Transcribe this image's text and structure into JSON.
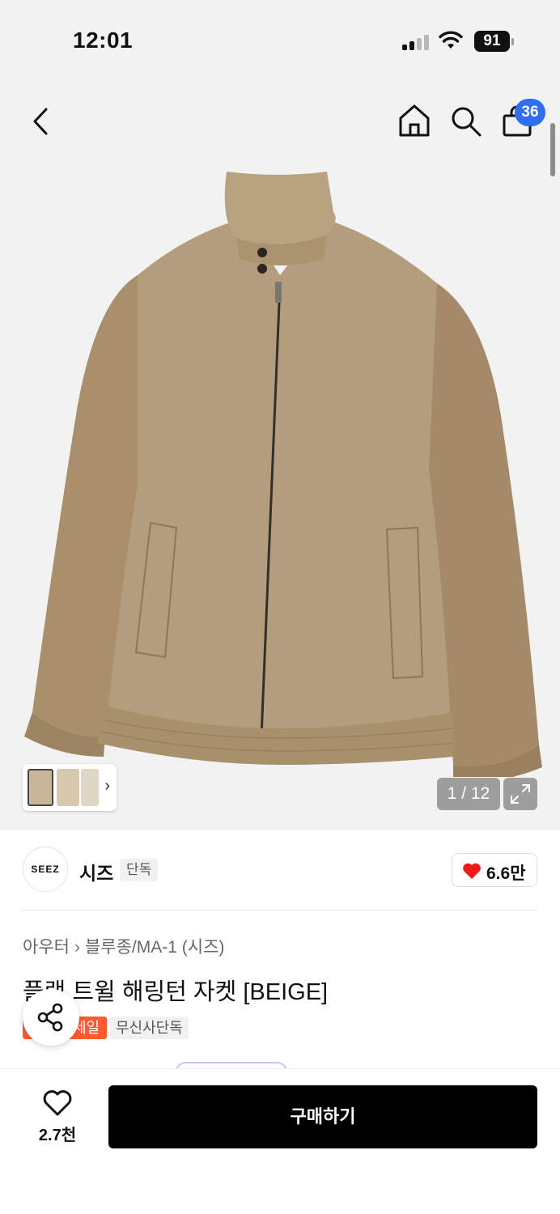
{
  "status_bar": {
    "time": "12:01",
    "battery": "91",
    "icons": [
      "signal-icon",
      "wifi-icon",
      "battery-icon"
    ]
  },
  "nav": {
    "icons": [
      "back-chevron-icon",
      "home-icon",
      "search-icon",
      "cart-icon"
    ],
    "cart_count": "36"
  },
  "gallery": {
    "counter": "1 / 12",
    "thumbnail_chevron": "›",
    "expand_icon": "expand-icon"
  },
  "brand": {
    "logo_text": "SEEZ",
    "name": "시즈",
    "tag": "단독",
    "like_count": "6.6만"
  },
  "product": {
    "breadcrumb": [
      "아우터",
      "블루종/MA-1 (시즈)"
    ],
    "breadcrumb_separator": "›",
    "title": "플랙 트윌 해링턴 자켓 [BEIGE]",
    "tags": [
      "세일",
      "무신사단독"
    ],
    "tag_visible_fragment": "세일"
  },
  "bottom_bar": {
    "wish_count": "2.7천",
    "buy_label": "구매하기"
  },
  "colors": {
    "accent_blue": "#2f6ef0",
    "sale_orange": "#ff5a32",
    "like_red": "#f01818",
    "jacket_beige": "#b49d7c",
    "buy_button": "#000000"
  }
}
